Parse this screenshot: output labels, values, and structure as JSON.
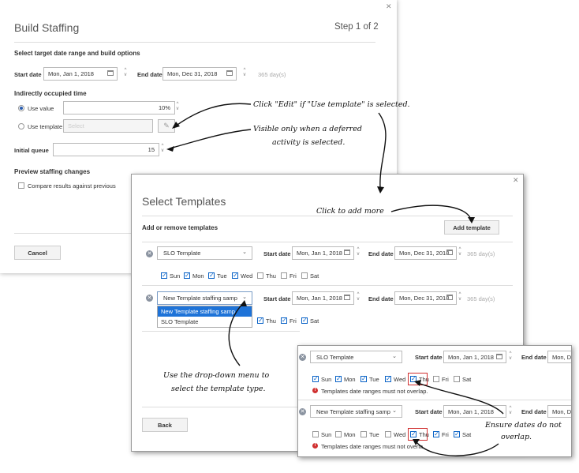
{
  "build": {
    "title": "Build Staffing",
    "step": "Step 1 of 2",
    "section_dates": "Select target date range and build options",
    "start_label": "Start date",
    "start_value": "Mon, Jan 1, 2018",
    "end_label": "End date",
    "end_value": "Mon, Dec 31, 2018",
    "days": "365 day(s)",
    "indirect_title": "Indirectly occupied time",
    "use_value": "Use value",
    "use_value_amount": "10%",
    "use_template": "Use template",
    "template_placeholder": "Select",
    "initial_queue": "Initial queue",
    "initial_queue_value": "15",
    "preview_title": "Preview staffing changes",
    "compare": "Compare results against previous",
    "cancel": "Cancel"
  },
  "templates": {
    "title": "Select Templates",
    "subtitle": "Add or remove templates",
    "add_button": "Add template",
    "start_label": "Start date",
    "end_label": "End date",
    "start_value": "Mon, Jan 1, 2018",
    "end_value": "Mon, Dec 31, 2018",
    "days": "365 day(s)",
    "row1_select": "SLO Template",
    "row2_select": "New Template staffing samp",
    "days_of_week": [
      "Sun",
      "Mon",
      "Tue",
      "Wed",
      "Thu",
      "Fri",
      "Sat"
    ],
    "dropdown_options": [
      "New Template staffing samp",
      "SLO Template"
    ],
    "back": "Back"
  },
  "zoom": {
    "row1_select": "SLO Template",
    "row2_select": "New Template staffing samp",
    "start_label": "Start date",
    "end_label": "End date",
    "start_value": "Mon, Jan 1, 2018",
    "end_value_partial": "Mon, De",
    "error": "Templates date ranges must not overlap.",
    "error_cut": "Templates date ranges must not overla"
  },
  "annotations": {
    "edit_note": "Click \"Edit\" if \"Use template\" is selected.",
    "visible_note_1": "Visible only when a deferred",
    "visible_note_2": "activity is selected.",
    "add_more": "Click to add more",
    "dropdown_note_1": "Use the drop-down menu to",
    "dropdown_note_2": "select the template type.",
    "ensure_1": "Ensure dates do not",
    "ensure_2": "overlap."
  }
}
